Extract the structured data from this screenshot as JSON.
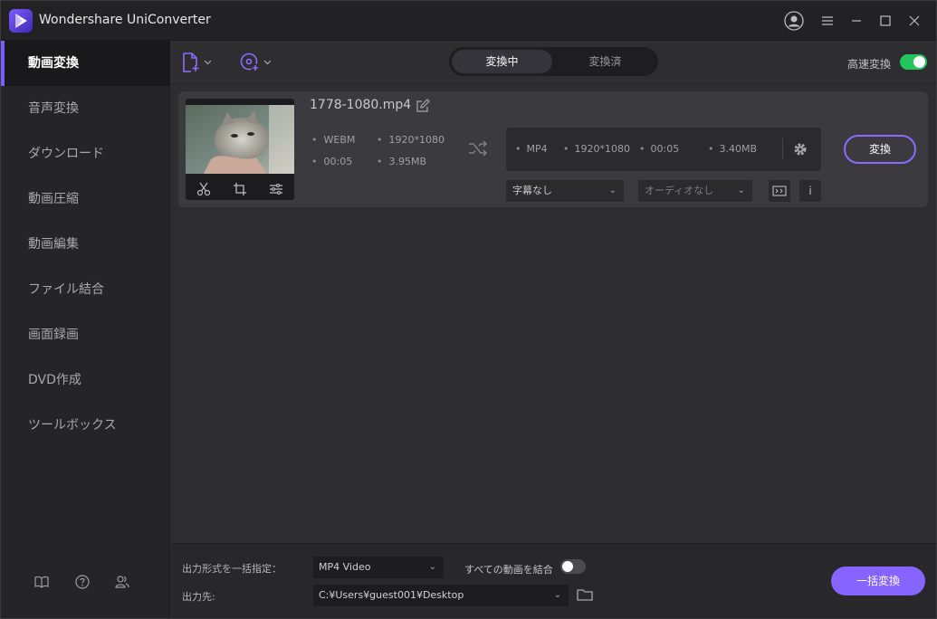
{
  "app": {
    "title": "Wondershare UniConverter"
  },
  "window_controls": [
    "account-icon",
    "menu-icon",
    "minimize-icon",
    "maximize-icon",
    "close-icon"
  ],
  "sidebar": {
    "items": [
      {
        "label": "動画変換",
        "active": true
      },
      {
        "label": "音声変換",
        "active": false
      },
      {
        "label": "ダウンロード",
        "active": false
      },
      {
        "label": "動画圧縮",
        "active": false
      },
      {
        "label": "動画編集",
        "active": false
      },
      {
        "label": "ファイル結合",
        "active": false
      },
      {
        "label": "画面録画",
        "active": false
      },
      {
        "label": "DVD作成",
        "active": false
      },
      {
        "label": "ツールボックス",
        "active": false
      }
    ],
    "footer_icons": [
      "book-icon",
      "help-icon",
      "users-icon"
    ]
  },
  "toolbar": {
    "tabs": [
      {
        "label": "変換中",
        "active": true
      },
      {
        "label": "変換済",
        "active": false
      }
    ],
    "speed_label": "高速変換",
    "speed_enabled": true
  },
  "file": {
    "filename": "1778-1080.mp4",
    "source": {
      "format": "WEBM",
      "resolution": "1920*1080",
      "duration": "00:05",
      "size": "3.95MB"
    },
    "target": {
      "format": "MP4",
      "resolution": "1920*1080",
      "duration": "00:05",
      "size": "3.40MB"
    },
    "subtitle_select": "字幕なし",
    "audio_select": "オーディオなし",
    "convert_label": "変換",
    "info_label": "i"
  },
  "footer": {
    "output_format_label": "出力形式を一括指定：",
    "output_format_value": "MP4 Video",
    "merge_label": "すべての動画を結合",
    "merge_enabled": false,
    "output_path_label": "出力先:",
    "output_path_value": "C:¥Users¥guest001¥Desktop",
    "convert_all_label": "一括変換"
  },
  "colors": {
    "accent": "#8564ff",
    "toggle_on": "#22c55e",
    "sidebar_bg": "#252528",
    "card_bg": "#3b3b3f"
  }
}
